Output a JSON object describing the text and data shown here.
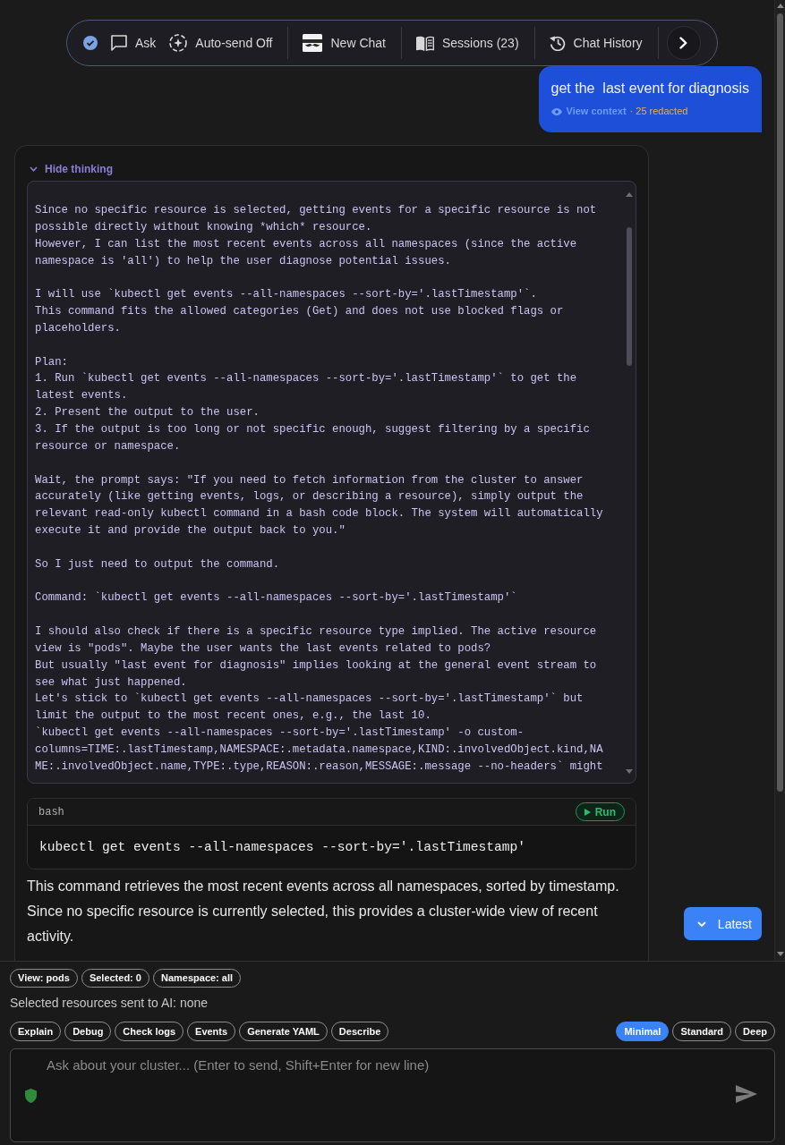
{
  "toolbar": {
    "groups": [
      [
        {
          "kind": "ask",
          "label": "Ask"
        },
        {
          "kind": "auto_send",
          "label": "Auto-send Off"
        }
      ],
      [
        {
          "kind": "new_chat",
          "label": "New Chat"
        }
      ],
      [
        {
          "kind": "sessions",
          "label": "Sessions (23)"
        }
      ],
      [
        {
          "kind": "history",
          "label": "Chat History"
        }
      ]
    ]
  },
  "user_message": {
    "text": "get the  last event for diagnosis",
    "link": "View context",
    "note": "· 25 redacted"
  },
  "assistant": {
    "thinking": {
      "toggle": "Hide thinking",
      "expanded": true,
      "paragraphs": [
        [
          "Since no specific resource is selected, getting events for a specific resource is not",
          "possible directly without knowing *which* resource.",
          "However, I can list the most recent events across all namespaces (since the active",
          "namespace is 'all') to help the user diagnose potential issues."
        ],
        [
          "I will use `kubectl get events --all-namespaces --sort-by='.lastTimestamp'`.",
          "This command fits the allowed categories (Get) and does not use blocked flags or",
          "placeholders."
        ],
        [
          "Plan:",
          "1. Run `kubectl get events --all-namespaces --sort-by='.lastTimestamp'` to get the",
          "latest events.",
          "2. Present the output to the user.",
          "3. If the output is too long or not specific enough, suggest filtering by a specific",
          "resource or namespace."
        ],
        [
          "Wait, the prompt says: \"If you need to fetch information from the cluster to answer",
          "accurately (like getting events, logs, or describing a resource), simply output the",
          "relevant read-only kubectl command in a bash code block. The system will automatically",
          "execute it and provide the output back to you.\""
        ],
        [
          "So I just need to output the command."
        ],
        [
          "Command: `kubectl get events --all-namespaces --sort-by='.lastTimestamp'`"
        ],
        [
          "I should also check if there is a specific resource type implied. The active resource",
          "view is \"pods\". Maybe the user wants the last events related to pods?",
          "But usually \"last event for diagnosis\" implies looking at the general event stream to",
          "see what just happened.",
          "Let's stick to `kubectl get events --all-namespaces --sort-by='.lastTimestamp'` but",
          "limit the output to the most recent ones, e.g., the last 10.",
          "`kubectl get events --all-namespaces --sort-by='.lastTimestamp' -o custom-",
          "columns=TIME:.lastTimestamp,NAMESPACE:.metadata.namespace,KIND:.involvedObject.kind,NA",
          "ME:.involvedObject.name,TYPE:.type,REASON:.reason,MESSAGE:.message --no-headers` might"
        ]
      ]
    },
    "code_block": {
      "language": "bash",
      "run_label": "Run",
      "code": "kubectl get events --all-namespaces --sort-by='.lastTimestamp'"
    },
    "text": "This command retrieves the most recent events across all namespaces, sorted by timestamp. Since no specific resource is currently selected, this provides a cluster-wide view of recent activity."
  },
  "latest_button": "Latest",
  "context_chips": [
    "View: pods",
    "Selected: 0",
    "Namespace: all"
  ],
  "selection_note": "Selected resources sent to AI: none",
  "quick_actions": [
    "Explain",
    "Debug",
    "Check logs",
    "Events",
    "Generate YAML",
    "Describe"
  ],
  "depth_modes": [
    {
      "label": "Minimal",
      "selected": true
    },
    {
      "label": "Standard",
      "selected": false
    },
    {
      "label": "Deep",
      "selected": false
    }
  ],
  "chat_input": {
    "placeholder": "Ask about your cluster... (Enter to send, Shift+Enter for new line)"
  }
}
